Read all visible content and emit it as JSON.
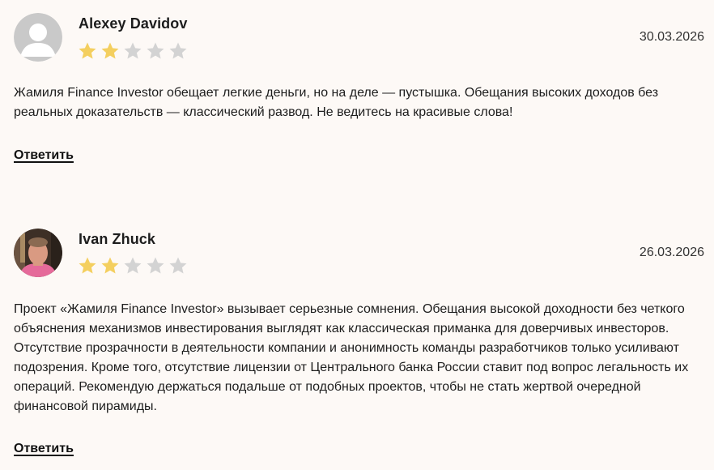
{
  "colors": {
    "background": "#fdf9f6",
    "star_filled": "#f4cf5f",
    "star_empty": "#d3d3d3",
    "text": "#1d1d1d"
  },
  "reviews": [
    {
      "author": "Alexey Davidov",
      "avatar": "default-avatar-placeholder",
      "rating": 2,
      "max_rating": 5,
      "date": "30.03.2026",
      "text": "Жамиля Finance Investor обещает легкие деньги, но на деле — пустышка. Обещания высоких доходов без реальных доказательств — классический развод. Не ведитесь на красивые слова!",
      "reply_label": "Ответить"
    },
    {
      "author": "Ivan Zhuck",
      "avatar": "user-photo",
      "rating": 2,
      "max_rating": 5,
      "date": "26.03.2026",
      "text": "Проект «Жамиля Finance Investor» вызывает серьезные сомнения. Обещания высокой доходности без четкого объяснения механизмов инвестирования выглядят как классическая приманка для доверчивых инвесторов. Отсутствие прозрачности в деятельности компании и анонимность команды разработчиков только усиливают подозрения. Кроме того, отсутствие лицензии от Центрального банка России ставит под вопрос легальность их операций. Рекомендую держаться подальше от подобных проектов, чтобы не стать жертвой очередной финансовой пирамиды.",
      "reply_label": "Ответить"
    }
  ]
}
